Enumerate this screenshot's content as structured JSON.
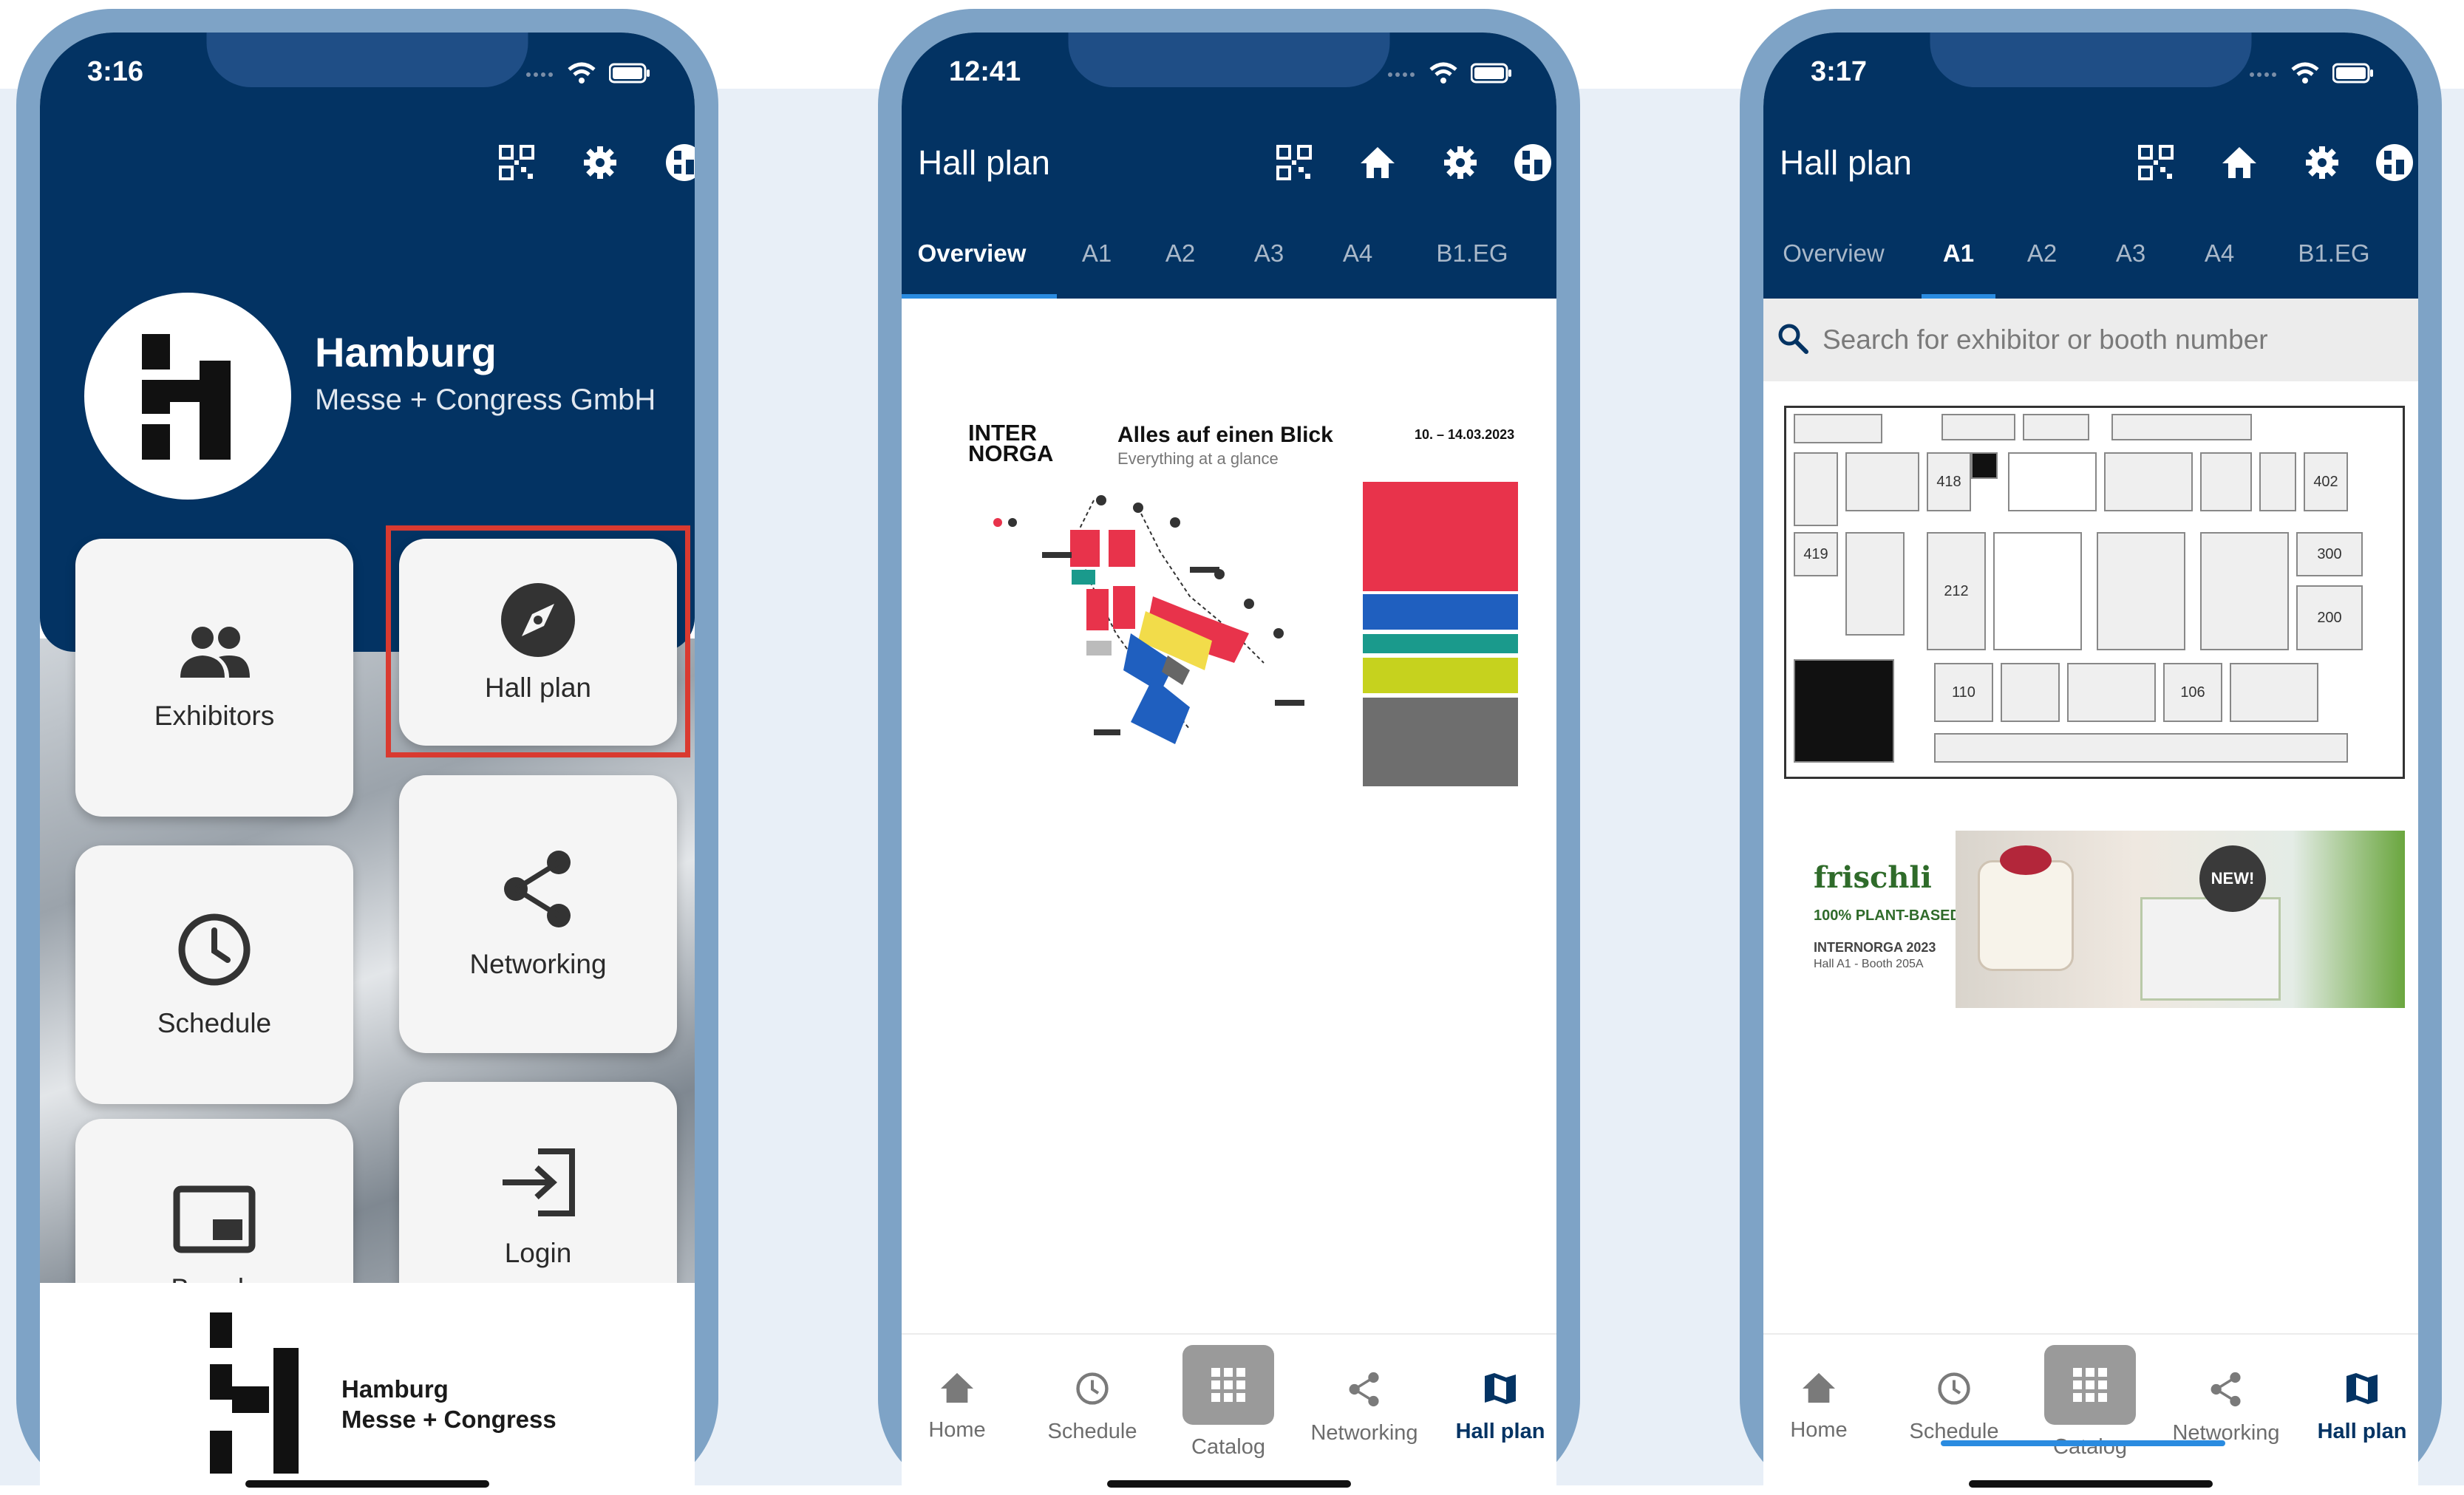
{
  "colors": {
    "primary": "#033363",
    "accent": "#2a8be0",
    "highlight": "#d93a30",
    "frame": "#7ea3c6"
  },
  "phone1": {
    "time": "3:16",
    "header_icons": [
      "qr-code-icon",
      "gear-icon",
      "language-globe-icon"
    ],
    "brand": {
      "name": "Hamburg",
      "subtitle": "Messe + Congress GmbH"
    },
    "tiles": [
      {
        "label": "Exhibitors",
        "icon": "people-icon"
      },
      {
        "label": "Hall plan",
        "icon": "compass-icon",
        "highlighted": true
      },
      {
        "label": "Schedule",
        "icon": "clock-icon"
      },
      {
        "label": "Networking",
        "icon": "share-icon"
      },
      {
        "label": "Brands",
        "icon": "picture-in-picture-icon"
      },
      {
        "label": "Login",
        "icon": "login-arrow-icon"
      }
    ],
    "footer": {
      "line1": "Hamburg",
      "line2": "Messe + Congress"
    }
  },
  "phone2": {
    "time": "12:41",
    "title": "Hall plan",
    "tabs": [
      "Overview",
      "A1",
      "A2",
      "A3",
      "A4",
      "B1.EG"
    ],
    "active_tab": "Overview",
    "doc": {
      "brand_line1": "INTER",
      "brand_line2": "NORGA",
      "headline": "Alles auf einen Blick",
      "subline": "Everything at a glance",
      "dates": "10. – 14.03.2023"
    },
    "nav": [
      "Home",
      "Schedule",
      "Catalog",
      "Networking",
      "Hall plan"
    ],
    "active_nav": "Hall plan"
  },
  "phone3": {
    "time": "3:17",
    "title": "Hall plan",
    "tabs": [
      "Overview",
      "A1",
      "A2",
      "A3",
      "A4",
      "B1.EG"
    ],
    "active_tab": "A1",
    "search_placeholder": "Search for exhibitor or booth number",
    "booths": [
      "402",
      "300",
      "419",
      "212",
      "110",
      "106",
      "200",
      "418"
    ],
    "ad": {
      "brand": "frischli",
      "tagline": "100% PLANT-BASED",
      "event": "INTERNORGA 2023",
      "location": "Hall A1 - Booth 205A",
      "badge": "NEW!"
    },
    "nav": [
      "Home",
      "Schedule",
      "Catalog",
      "Networking",
      "Hall plan"
    ],
    "active_nav": "Hall plan"
  }
}
